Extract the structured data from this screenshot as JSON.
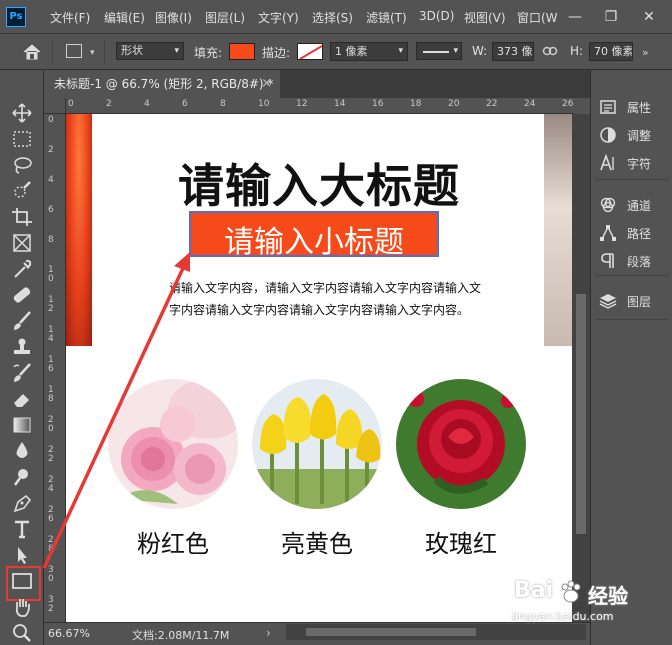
{
  "app": {
    "logo": "Ps",
    "menu": [
      "文件(F)",
      "编辑(E)",
      "图像(I)",
      "图层(L)",
      "文字(Y)",
      "选择(S)",
      "滤镜(T)",
      "3D(D)",
      "视图(V)",
      "窗口(W"
    ],
    "window_controls": [
      "—",
      "❐",
      "✕"
    ]
  },
  "options_bar": {
    "mode_value": "形状",
    "fill_label": "填充:",
    "fill_color": "#f64a1a",
    "stroke_label": "描边:",
    "stroke_width_value": "1 像素",
    "width_label": "W:",
    "width_value": "373 像",
    "height_label": "H:",
    "height_value": "70 像素"
  },
  "document": {
    "tab_title": "未标题-1 @ 66.7% (矩形 2, RGB/8#) *",
    "tab_close": "×"
  },
  "ruler": {
    "h_labels": [
      "0",
      "2",
      "4",
      "6",
      "8",
      "10",
      "12",
      "14",
      "16",
      "18",
      "20",
      "22",
      "24",
      "26"
    ],
    "v_labels": [
      "0",
      "2",
      "4",
      "6",
      "8",
      "1 0",
      "1 2",
      "1 4",
      "1 6",
      "1 8",
      "2 0",
      "2 2",
      "2 4",
      "2 6",
      "2 8",
      "3 0",
      "3 2"
    ]
  },
  "canvas": {
    "big_title": "请输入大标题",
    "sub_title": "请输入小标题",
    "body_text": "请输入文字内容，请输入文字内容请输入文字内容请输入文字内容请输入文字内容请输入文字内容请输入文字内容。",
    "flowers": [
      {
        "label": "粉红色",
        "color": "#f2a8c0"
      },
      {
        "label": "亮黄色",
        "color": "#f5d21a"
      },
      {
        "label": "玫瑰红",
        "color": "#c8102e"
      }
    ]
  },
  "status": {
    "zoom": "66.67%",
    "doc_size": "文档:2.08M/11.7M",
    "arrow": "›"
  },
  "panels": {
    "group1": [
      "属性",
      "调整",
      "字符"
    ],
    "group2": [
      "通道",
      "路径",
      "段落"
    ],
    "group3": [
      "图层"
    ]
  },
  "watermark": {
    "brand": "Bai",
    "brand_suffix": "经验",
    "url": "jingyan.baidu.com"
  },
  "tools": [
    "move-icon",
    "marquee-icon",
    "lasso-icon",
    "quick-select-icon",
    "crop-icon",
    "frame-icon",
    "eyedropper-icon",
    "healing-icon",
    "brush-icon",
    "stamp-icon",
    "history-brush-icon",
    "eraser-icon",
    "gradient-icon",
    "blur-icon",
    "dodge-icon",
    "pen-icon",
    "type-icon",
    "path-select-icon",
    "rectangle-icon",
    "hand-icon",
    "zoom-icon"
  ]
}
